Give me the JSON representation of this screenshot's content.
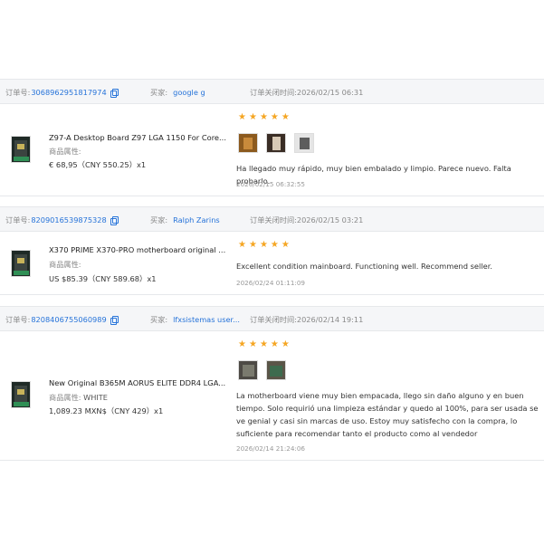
{
  "labels": {
    "order_no": "订单号:",
    "buyer": "买家:",
    "closed_time": "订单关闭时间:",
    "attr": "商品属性:"
  },
  "colors": {
    "link": "#2673d9",
    "star": "#f5a623",
    "header_bg": "#f5f6f8"
  },
  "orders": [
    {
      "order_no": "3068962951817974",
      "buyer": "google g",
      "closed_time": "2026/02/15 06:31",
      "product_title": "Z97-A Desktop Board Z97 LGA 1150 For Core...",
      "attr_value": "",
      "price": "€ 68,95（CNY  550.25）x1",
      "rating": 5,
      "photos": [
        "product-photo",
        "product-photo",
        "product-photo"
      ],
      "review": "Ha llegado muy rápido, muy bien embalado y limpio. Parece nuevo. Falta probarlo.",
      "review_date": "2026/02/15 06:32:55"
    },
    {
      "order_no": "8209016539875328",
      "buyer": "Ralph Zarins",
      "closed_time": "2026/02/15 03:21",
      "product_title": "X370 PRIME X370-PRO motherboard original ...",
      "attr_value": "",
      "price": "US $85.39（CNY  589.68）x1",
      "rating": 5,
      "photos": [],
      "review": "Excellent condition mainboard. Functioning well. Recommend seller.",
      "review_date": "2026/02/24 01:11:09"
    },
    {
      "order_no": "8208406755060989",
      "buyer": "lfxsistemas user...",
      "closed_time": "2026/02/14 19:11",
      "product_title": "New Original B365M AORUS ELITE DDR4 LGA...",
      "attr_value": "WHITE",
      "price": "1,089.23 MXN$（CNY  429）x1",
      "rating": 5,
      "photos": [
        "product-photo",
        "product-photo"
      ],
      "review": "La motherboard viene muy bien empacada, llego sin daño alguno y en buen tiempo. Solo requirió una limpieza estándar y quedo al 100%, para ser usada se ve genial y casi sin marcas de uso. Estoy muy satisfecho con la compra, lo suficiente para recomendar tanto el producto como al vendedor",
      "review_date": "2026/02/14 21:24:06"
    }
  ]
}
